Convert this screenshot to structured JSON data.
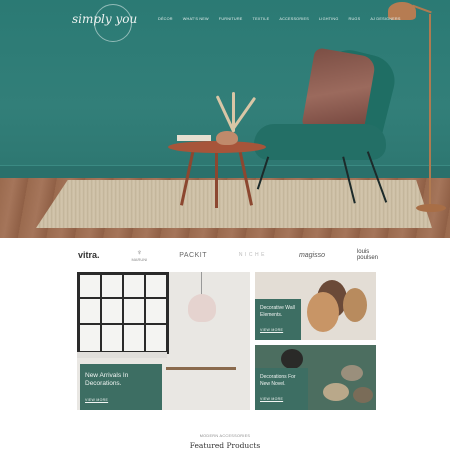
{
  "header": {
    "logo": "simply you",
    "nav": [
      "DÉCOR",
      "WHAT'S NEW",
      "FURNITURE",
      "TEXTILE",
      "ACCESSORIES",
      "LIGHTING",
      "RUGS",
      "AJ DESIGNERS"
    ]
  },
  "brands": {
    "vitra": "vitra.",
    "maruni": "MARUNI",
    "packit": "PACKIT",
    "niche": "NICHE",
    "magis": "magisso",
    "louis_line1": "louis",
    "louis_line2": "poulsen"
  },
  "promos": {
    "arrivals": {
      "title_line1": "New Arrivals In",
      "title_line2": "Decorations.",
      "link": "VIEW MORE"
    },
    "wall": {
      "title_line1": "Decorative Wall",
      "title_line2": "Elements.",
      "link": "VIEW MORE"
    },
    "vases": {
      "title_line1": "Decorations For",
      "title_line2": "New Novel.",
      "link": "VIEW MORE"
    }
  },
  "featured": {
    "eyebrow": "MODERN ACCESSORIES",
    "title": "Featured Products"
  },
  "colors": {
    "wall_teal": "#2f7f78",
    "promo_overlay": "#3d6e63",
    "chair": "#236f66"
  }
}
